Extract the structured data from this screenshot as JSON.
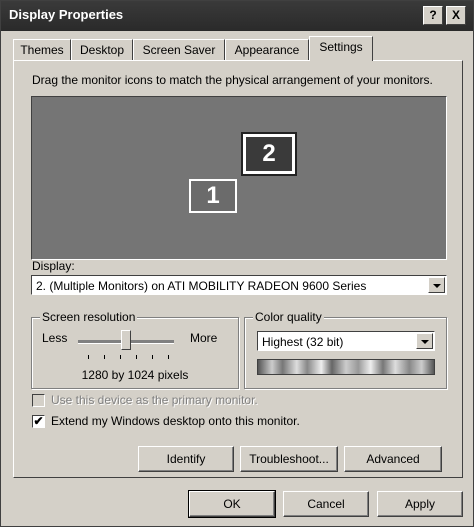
{
  "window": {
    "title": "Display Properties",
    "help_label": "?",
    "close_label": "X"
  },
  "tabs": [
    {
      "label": "Themes"
    },
    {
      "label": "Desktop"
    },
    {
      "label": "Screen Saver"
    },
    {
      "label": "Appearance"
    },
    {
      "label": "Settings",
      "active": true
    }
  ],
  "settings": {
    "instruction": "Drag the monitor icons to match the physical arrangement of your monitors.",
    "monitors": [
      {
        "label": "1"
      },
      {
        "label": "2",
        "selected": true
      }
    ],
    "display_label": "Display:",
    "display_value": "2. (Multiple Monitors) on ATI MOBILITY RADEON 9600 Series",
    "screen_resolution": {
      "legend": "Screen resolution",
      "less_label": "Less",
      "more_label": "More",
      "value_text": "1280 by 1024 pixels",
      "slider_position": 0.5
    },
    "color_quality": {
      "legend": "Color quality",
      "value": "Highest (32 bit)"
    },
    "primary_checkbox": {
      "label": "Use this device as the primary monitor.",
      "checked": false,
      "disabled": true
    },
    "extend_checkbox": {
      "label": "Extend my Windows desktop onto this monitor.",
      "checked": true,
      "mark": "✔"
    },
    "buttons": {
      "identify": "Identify",
      "troubleshoot": "Troubleshoot...",
      "advanced": "Advanced"
    }
  },
  "footer": {
    "ok": "OK",
    "cancel": "Cancel",
    "apply": "Apply"
  }
}
